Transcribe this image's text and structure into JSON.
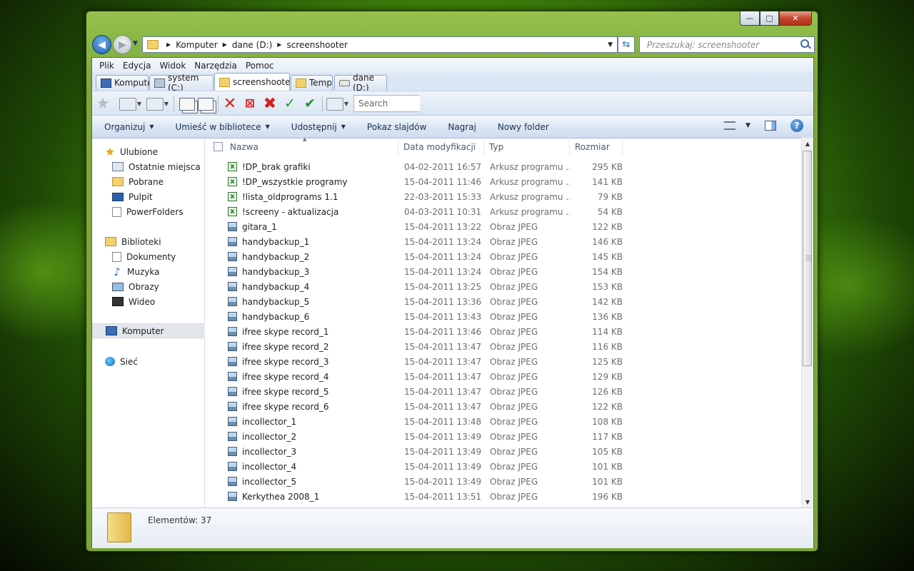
{
  "window": {
    "controls": {
      "minimize": "—",
      "maximize": "□",
      "close": "✕"
    }
  },
  "navigation": {
    "back": "◀",
    "forward": "▶",
    "address": {
      "crumbs": [
        "Komputer",
        "dane (D:)",
        "screenshooter"
      ]
    },
    "search_placeholder": "Przeszukaj: screenshooter"
  },
  "menu": [
    "Plik",
    "Edycja",
    "Widok",
    "Narzędzia",
    "Pomoc"
  ],
  "tabs": [
    {
      "label": "Komputer",
      "icon": "computer-icon"
    },
    {
      "label": "system (C:)",
      "icon": "system-drive-icon"
    },
    {
      "label": "screenshooter",
      "icon": "folder-icon",
      "active": true
    },
    {
      "label": "Temp",
      "icon": "folder-icon"
    },
    {
      "label": "dane (D:)",
      "icon": "drive-icon"
    }
  ],
  "toolbar": {
    "search_placeholder": "Search"
  },
  "commands": [
    {
      "label": "Organizuj",
      "dropdown": true
    },
    {
      "label": "Umieść w bibliotece",
      "dropdown": true
    },
    {
      "label": "Udostępnij",
      "dropdown": true
    },
    {
      "label": "Pokaz slajdów",
      "dropdown": false
    },
    {
      "label": "Nagraj",
      "dropdown": false
    },
    {
      "label": "Nowy folder",
      "dropdown": false
    }
  ],
  "sidebar": {
    "favorites": {
      "label": "Ulubione",
      "items": [
        "Ostatnie miejsca",
        "Pobrane",
        "Pulpit",
        "PowerFolders"
      ]
    },
    "libraries": {
      "label": "Biblioteki",
      "items": [
        "Dokumenty",
        "Muzyka",
        "Obrazy",
        "Wideo"
      ]
    },
    "computer": "Komputer",
    "network": "Sieć"
  },
  "columns": {
    "name": "Nazwa",
    "date": "Data modyfikacji",
    "type": "Typ",
    "size": "Rozmiar"
  },
  "files": [
    {
      "name": "!DP_brak grafiki",
      "date": "04-02-2011 16:57",
      "type": "Arkusz programu ...",
      "size": "295 KB",
      "icon": "spreadsheet-icon"
    },
    {
      "name": "!DP_wszystkie programy",
      "date": "15-04-2011 11:46",
      "type": "Arkusz programu ...",
      "size": "141 KB",
      "icon": "spreadsheet-icon"
    },
    {
      "name": "!lista_oldprograms 1.1",
      "date": "22-03-2011 15:33",
      "type": "Arkusz programu ...",
      "size": "79 KB",
      "icon": "spreadsheet-icon"
    },
    {
      "name": "!screeny - aktualizacja",
      "date": "04-03-2011 10:31",
      "type": "Arkusz programu ...",
      "size": "54 KB",
      "icon": "spreadsheet-icon"
    },
    {
      "name": "gitara_1",
      "date": "15-04-2011 13:22",
      "type": "Obraz JPEG",
      "size": "122 KB",
      "icon": "jpeg-image-icon"
    },
    {
      "name": "handybackup_1",
      "date": "15-04-2011 13:24",
      "type": "Obraz JPEG",
      "size": "146 KB",
      "icon": "jpeg-image-icon"
    },
    {
      "name": "handybackup_2",
      "date": "15-04-2011 13:24",
      "type": "Obraz JPEG",
      "size": "145 KB",
      "icon": "jpeg-image-icon"
    },
    {
      "name": "handybackup_3",
      "date": "15-04-2011 13:24",
      "type": "Obraz JPEG",
      "size": "154 KB",
      "icon": "jpeg-image-icon"
    },
    {
      "name": "handybackup_4",
      "date": "15-04-2011 13:25",
      "type": "Obraz JPEG",
      "size": "153 KB",
      "icon": "jpeg-image-icon"
    },
    {
      "name": "handybackup_5",
      "date": "15-04-2011 13:36",
      "type": "Obraz JPEG",
      "size": "142 KB",
      "icon": "jpeg-image-icon"
    },
    {
      "name": "handybackup_6",
      "date": "15-04-2011 13:43",
      "type": "Obraz JPEG",
      "size": "136 KB",
      "icon": "jpeg-image-icon"
    },
    {
      "name": "ifree skype record_1",
      "date": "15-04-2011 13:46",
      "type": "Obraz JPEG",
      "size": "114 KB",
      "icon": "jpeg-image-icon"
    },
    {
      "name": "ifree skype record_2",
      "date": "15-04-2011 13:47",
      "type": "Obraz JPEG",
      "size": "116 KB",
      "icon": "jpeg-image-icon"
    },
    {
      "name": "ifree skype record_3",
      "date": "15-04-2011 13:47",
      "type": "Obraz JPEG",
      "size": "125 KB",
      "icon": "jpeg-image-icon"
    },
    {
      "name": "ifree skype record_4",
      "date": "15-04-2011 13:47",
      "type": "Obraz JPEG",
      "size": "129 KB",
      "icon": "jpeg-image-icon"
    },
    {
      "name": "ifree skype record_5",
      "date": "15-04-2011 13:47",
      "type": "Obraz JPEG",
      "size": "126 KB",
      "icon": "jpeg-image-icon"
    },
    {
      "name": "ifree skype record_6",
      "date": "15-04-2011 13:47",
      "type": "Obraz JPEG",
      "size": "122 KB",
      "icon": "jpeg-image-icon"
    },
    {
      "name": "incollector_1",
      "date": "15-04-2011 13:48",
      "type": "Obraz JPEG",
      "size": "108 KB",
      "icon": "jpeg-image-icon"
    },
    {
      "name": "incollector_2",
      "date": "15-04-2011 13:49",
      "type": "Obraz JPEG",
      "size": "117 KB",
      "icon": "jpeg-image-icon"
    },
    {
      "name": "incollector_3",
      "date": "15-04-2011 13:49",
      "type": "Obraz JPEG",
      "size": "105 KB",
      "icon": "jpeg-image-icon"
    },
    {
      "name": "incollector_4",
      "date": "15-04-2011 13:49",
      "type": "Obraz JPEG",
      "size": "101 KB",
      "icon": "jpeg-image-icon"
    },
    {
      "name": "incollector_5",
      "date": "15-04-2011 13:49",
      "type": "Obraz JPEG",
      "size": "101 KB",
      "icon": "jpeg-image-icon"
    },
    {
      "name": "Kerkythea 2008_1",
      "date": "15-04-2011 13:51",
      "type": "Obraz JPEG",
      "size": "196 KB",
      "icon": "jpeg-image-icon"
    }
  ],
  "status": {
    "text": "Elementów: 37"
  }
}
